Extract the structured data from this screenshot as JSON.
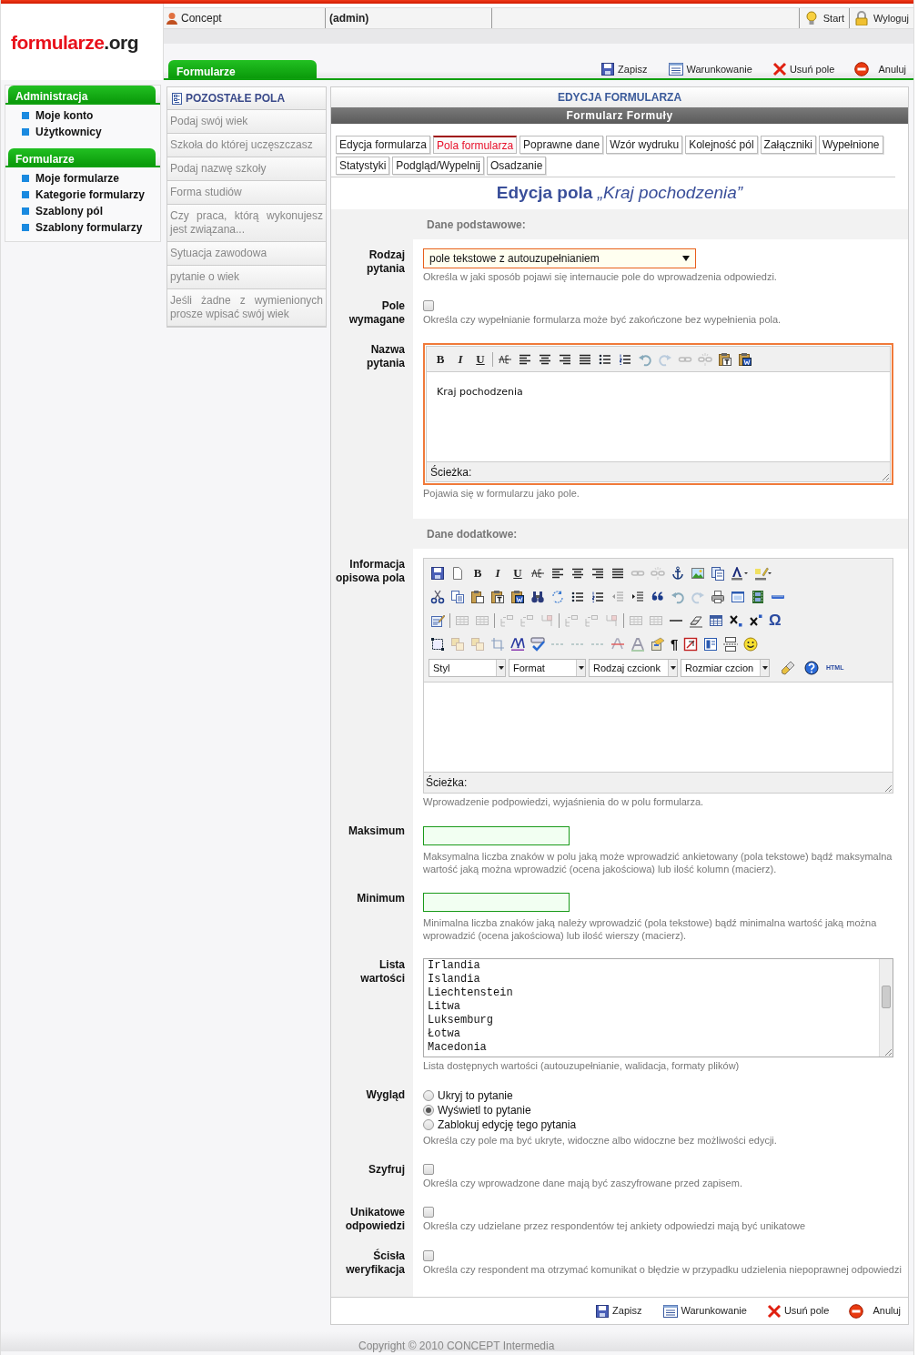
{
  "header": {
    "logo": {
      "name": "formularze",
      "tld": ".org"
    },
    "user": "Concept",
    "role": "(admin)",
    "links": [
      {
        "kind": "start",
        "label": "Start"
      },
      {
        "kind": "logout",
        "label": "Wyloguj"
      }
    ]
  },
  "module_tab": "Formularze",
  "top_actions": [
    {
      "kind": "save",
      "label": "Zapisz"
    },
    {
      "kind": "conditions",
      "label": "Warunkowanie"
    },
    {
      "kind": "delete",
      "label": "Usuń pole"
    },
    {
      "kind": "cancel",
      "label": "Anuluj"
    }
  ],
  "sidebar": {
    "sections": [
      {
        "title": "Administracja",
        "items": [
          "Moje konto",
          "Użytkownicy"
        ]
      },
      {
        "title": "Formularze",
        "items": [
          "Moje formularze",
          "Kategorie formularzy",
          "Szablony pól",
          "Szablony formularzy"
        ]
      }
    ]
  },
  "other_fields": {
    "title": "POZOSTAŁE POLA",
    "items": [
      "Podaj swój wiek",
      "Szkoła do której uczęszczasz",
      "Podaj nazwę szkoły",
      "Forma studiów",
      "Czy praca, którą wykonujesz jest związana...",
      "Sytuacja zawodowa",
      "pytanie o wiek",
      "Jeśli żadne z wymienionych prosze wpisać swój wiek"
    ]
  },
  "panel": {
    "title": "EDYCJA FORMULARZA",
    "form_name": "Formularz Formuły",
    "tabs": [
      {
        "label": "Edycja formularza",
        "selected": false
      },
      {
        "label": "Pola formularza",
        "selected": true
      },
      {
        "label": "Poprawne dane",
        "selected": false
      },
      {
        "label": "Wzór wydruku",
        "selected": false
      },
      {
        "label": "Kolejność pól",
        "selected": false
      },
      {
        "label": "Załączniki",
        "selected": false
      },
      {
        "label": "Wypełnione",
        "selected": false
      },
      {
        "label": "Statystyki",
        "selected": false
      },
      {
        "label": "Podgląd/Wypelnij",
        "selected": false
      },
      {
        "label": "Osadzanie",
        "selected": false
      }
    ],
    "heading": "**Edycja pola** *„Kraj pochodzenia”*"
  },
  "sections": [
    {
      "title": "Dane podstawowe:",
      "fields": [
        {
          "kind": "select",
          "label": "Rodzaj pytania",
          "value": "pole tekstowe z autouzupełnianiem",
          "hint": "Określa w jaki sposób pojawi się internaucie pole do wprowadzenia odpowiedzi."
        },
        {
          "kind": "checkbox",
          "label": "Pole wymagane",
          "checked": false,
          "hint": "Określa czy wypełnianie formularza może być zakończone bez wypełnienia pola."
        },
        {
          "kind": "editor_simple",
          "label": "Nazwa pytania",
          "toolbar_text": [
            "B",
            "I",
            "U"
          ],
          "value": "Kraj pochodzenia",
          "path_label": "Ścieżka:",
          "hint": "Pojawia się w formularzu jako pole."
        }
      ]
    },
    {
      "title": "Dane dodatkowe:",
      "fields": [
        {
          "kind": "editor_full",
          "label": "Informacja opisowa pola",
          "toolbar_text": [
            "B",
            "I",
            "U"
          ],
          "pilcrow": "¶",
          "omega": "Ω",
          "dropdowns": [
            "Styl",
            "Format",
            "Rodzaj czcionk",
            "Rozmiar czcion"
          ],
          "html_label": "HTML",
          "path_label": "Ścieżka:",
          "hint": "Wprowadzenie podpowiedzi, wyjaśnienia do w polu formularza."
        },
        {
          "kind": "text",
          "label": "Maksimum",
          "hint": "Maksymalna liczba znaków w polu jaką może wprowadzić ankietowany (pola tekstowe) bądź maksymalna wartość jaką można wprowadzić (ocena jakościowa) lub ilość kolumn (macierz)."
        },
        {
          "kind": "text",
          "label": "Minimum",
          "hint": "Minimalna liczba znaków jaką należy wprowadzić (pola tekstowe) bądź minimalna wartość jaką można wprowadzić (ocena jakościowa) lub ilość wierszy (macierz)."
        },
        {
          "kind": "list",
          "label": "Lista wartości",
          "lines": [
            "Irlandia",
            "Islandia",
            "Liechtenstein",
            "Litwa",
            "Luksemburg",
            "Łotwa",
            "Macedonia"
          ],
          "hint": "Lista dostępnych wartości (autouzupełnianie, walidacja, formaty plików)"
        },
        {
          "kind": "radio",
          "label": "Wygląd",
          "options": [
            {
              "label": "Ukryj to pytanie",
              "selected": false
            },
            {
              "label": "Wyświetl to pytanie",
              "selected": true
            },
            {
              "label": "Zablokuj edycję tego pytania",
              "selected": false
            }
          ],
          "hint": "Określa czy pole ma być ukryte, widoczne albo widoczne bez możliwości edycji."
        },
        {
          "kind": "checkbox",
          "label": "Szyfruj",
          "checked": false,
          "hint": "Określa czy wprowadzone dane mają być zaszyfrowane przed zapisem."
        },
        {
          "kind": "checkbox",
          "label": "Unikatowe odpowiedzi",
          "checked": false,
          "hint": "Określa czy udzielane przez respondentów tej ankiety odpowiedzi mają być unikatowe"
        },
        {
          "kind": "checkbox",
          "label": "Ścisła weryfikacja",
          "checked": false,
          "hint": "Określa czy respondent ma otrzymać komunikat o błędzie w przypadku udzielenia niepoprawnej odpowiedzi"
        }
      ]
    }
  ],
  "bottom_actions": [
    {
      "kind": "save",
      "label": "Zapisz"
    },
    {
      "kind": "conditions",
      "label": "Warunkowanie"
    },
    {
      "kind": "delete",
      "label": "Usuń pole"
    },
    {
      "kind": "cancel",
      "label": "Anuluj"
    }
  ],
  "footer": "Copyright © 2010 CONCEPT Intermedia"
}
